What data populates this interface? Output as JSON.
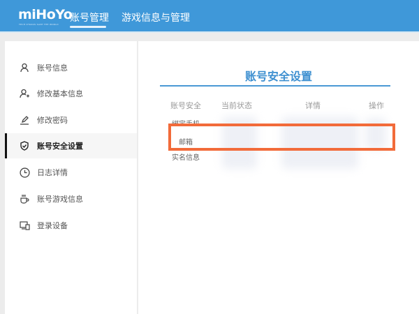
{
  "header": {
    "logo": "miHoYo",
    "logo_tagline": "TECH OTAKUS SAVE THE WORLD",
    "nav": [
      {
        "label": "账号管理",
        "active": true
      },
      {
        "label": "游戏信息与管理",
        "active": false
      }
    ]
  },
  "sidebar": {
    "items": [
      {
        "label": "账号信息",
        "icon": "user-icon"
      },
      {
        "label": "修改基本信息",
        "icon": "user-edit-icon"
      },
      {
        "label": "修改密码",
        "icon": "pencil-icon"
      },
      {
        "label": "账号安全设置",
        "icon": "shield-check-icon",
        "active": true
      },
      {
        "label": "日志详情",
        "icon": "clock-icon"
      },
      {
        "label": "账号游戏信息",
        "icon": "cup-icon"
      },
      {
        "label": "登录设备",
        "icon": "devices-icon"
      }
    ]
  },
  "main": {
    "title": "账号安全设置",
    "columns": [
      "账号安全",
      "当前状态",
      "详情",
      "操作"
    ],
    "rows": [
      "绑定手机",
      "邮箱",
      "实名信息"
    ]
  },
  "colors": {
    "header": "#3f98d9",
    "accent": "#3d8fd0",
    "highlight": "#f26b3a"
  }
}
